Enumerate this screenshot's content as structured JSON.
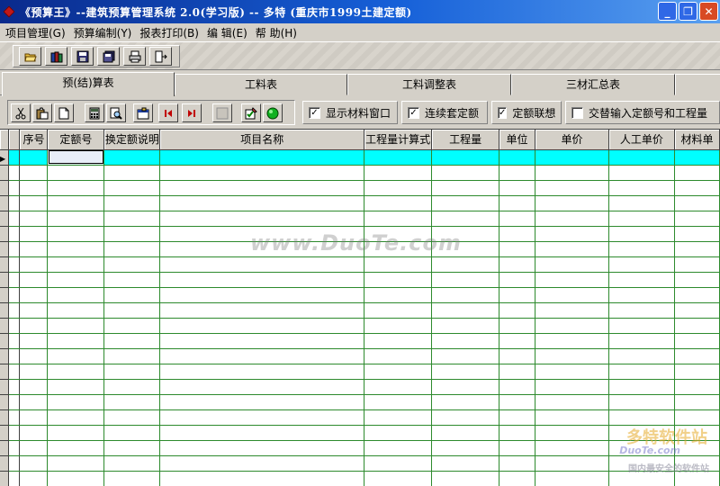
{
  "window": {
    "title": "《预算王》--建筑预算管理系统 2.0(学习版) -- 多特 (重庆市1999土建定额)",
    "buttons": {
      "minimize": "_",
      "maximize": "❐",
      "close": "✕"
    }
  },
  "menu": [
    {
      "label": "项目管理(G)"
    },
    {
      "label": "预算编制(Y)"
    },
    {
      "label": "报表打印(B)"
    },
    {
      "label": "编 辑(E)"
    },
    {
      "label": "帮 助(H)"
    }
  ],
  "toolbar": {
    "buttons": [
      {
        "icon": "open-folder-icon"
      },
      {
        "icon": "books-icon"
      },
      {
        "icon": "save-disk-icon"
      },
      {
        "icon": "save-all-icon"
      },
      {
        "icon": "printer-icon"
      },
      {
        "icon": "exit-door-icon"
      }
    ]
  },
  "tabs": [
    {
      "label": "预(结)算表",
      "active": true
    },
    {
      "label": "工料表",
      "active": false
    },
    {
      "label": "工料调整表",
      "active": false
    },
    {
      "label": "三材汇总表",
      "active": false
    }
  ],
  "subtoolbar": {
    "buttons": [
      {
        "icon": "cut-icon"
      },
      {
        "icon": "paste-icon"
      },
      {
        "icon": "new-doc-icon"
      },
      {
        "icon": "calculator-icon"
      },
      {
        "icon": "find-icon"
      },
      {
        "icon": "properties-icon"
      },
      {
        "icon": "first-record-icon"
      },
      {
        "icon": "last-record-icon"
      },
      {
        "icon": "blank-icon"
      },
      {
        "icon": "edit-check-icon"
      },
      {
        "icon": "green-circle-icon"
      }
    ],
    "checkboxes": [
      {
        "label": "显示材料窗口",
        "checked": true
      },
      {
        "label": "连续套定额",
        "checked": true
      },
      {
        "label": "定额联想",
        "checked": true
      },
      {
        "label": "交替输入定额号和工程量",
        "checked": false
      }
    ]
  },
  "grid": {
    "columns": [
      "序号",
      "定额号",
      "换定额说明",
      "项目名称",
      "工程量计算式",
      "工程量",
      "单位",
      "单价",
      "人工单价",
      "材料单"
    ],
    "row_marker": "▶"
  },
  "watermark": {
    "site": "www.DuoTe.com",
    "brand_cn": "多特软件站",
    "brand_url": "DuoTe.com",
    "brand_slogan": "国内最安全的软件站"
  },
  "colors": {
    "titlebar": "#0a2a8c",
    "active_row": "#00ffff",
    "grid_lines": "#2d8a2d",
    "face": "#d4d0c8"
  }
}
